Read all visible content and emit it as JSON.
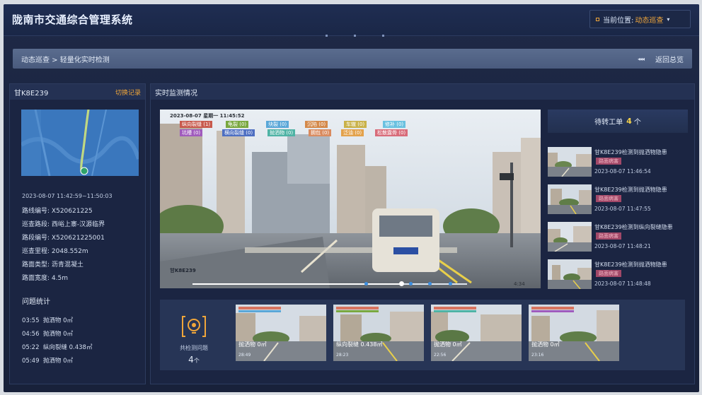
{
  "header": {
    "title": "陇南市交通综合管理系统",
    "location_label": "当前位置:",
    "location_value": "动态巡查",
    "location_caret": "▾"
  },
  "breadcrumb": {
    "path": "动态巡查 > 轻量化实时检测",
    "arrows": "◂◂◂",
    "back_label": "返回总览"
  },
  "left_panel": {
    "plate": "甘K8E239",
    "switch_label": "切换记录",
    "map_time_range": "2023-08-07 11:42:59~11:50:03",
    "info": [
      {
        "label": "路线编号:",
        "value": "X520621225"
      },
      {
        "label": "巡查路段:",
        "value": "西峪上寨-汉源临界"
      },
      {
        "label": "路段编号:",
        "value": "X520621225001"
      },
      {
        "label": "巡查里程:",
        "value": "2048.552m"
      },
      {
        "label": "路面类型:",
        "value": "沥青混凝土"
      },
      {
        "label": "路面宽度:",
        "value": "4.5m"
      }
    ],
    "stats_title": "问题统计",
    "stats": [
      {
        "time": "03:55",
        "type": "抛洒物",
        "value": "0㎡"
      },
      {
        "time": "04:56",
        "type": "抛洒物",
        "value": "0㎡"
      },
      {
        "time": "05:22",
        "type": "纵向裂缝",
        "value": "0.438㎡"
      },
      {
        "time": "05:49",
        "type": "抛洒物",
        "value": "0㎡"
      }
    ]
  },
  "main_panel": {
    "title": "实时监测情况",
    "video": {
      "timestamp": "2023-08-07   星期一  11:45:52",
      "tags_row1": [
        "纵向裂缝 (1)",
        "龟裂 (0)",
        "块裂 (0)",
        "沉陷 (0)",
        "车辙 (0)",
        "修补 (0)"
      ],
      "tags_row2": [
        "坑槽 (0)",
        "横向裂缝 (0)",
        "抛洒物 (0)",
        "拥包 (0)",
        "泛油 (0)",
        "松散露骨 (0)"
      ],
      "plate_watermark": "甘K8E239",
      "elapsed": "4:34",
      "progress": 0.76
    },
    "pending": {
      "label": "待转工单",
      "count": "4",
      "unit": "个"
    },
    "work_orders": [
      {
        "title": "甘K8E239检测到抛洒物隐患",
        "badge": "路面病害",
        "time": "2023-08-07 11:46:54"
      },
      {
        "title": "甘K8E239检测到抛洒物隐患",
        "badge": "路面病害",
        "time": "2023-08-07 11:47:55"
      },
      {
        "title": "甘K8E239检测到纵向裂缝隐患",
        "badge": "路面病害",
        "time": "2023-08-07 11:48:21"
      },
      {
        "title": "甘K8E239检测到抛洒物隐患",
        "badge": "路面病害",
        "time": "2023-08-07 11:48:48"
      }
    ],
    "detected": {
      "label": "共检测问题",
      "count": "4",
      "unit": "个"
    },
    "clips": [
      {
        "caption": "抛洒物 0㎡",
        "time": "28:49"
      },
      {
        "caption": "纵向裂缝 0.438㎡",
        "time": "28:23"
      },
      {
        "caption": "抛洒物 0㎡",
        "time": "22:56"
      },
      {
        "caption": "抛洒物 0㎡",
        "time": "23:16"
      }
    ]
  },
  "colors": {
    "accent": "#f0a63a",
    "count": "#f5d24a",
    "badge_bg": "#a24868",
    "panel": "#1b2542"
  }
}
